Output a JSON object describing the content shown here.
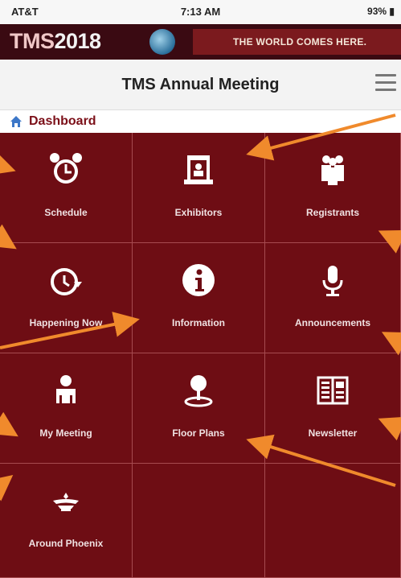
{
  "status": {
    "carrier": "AT&T",
    "time": "7:13 AM",
    "battery": "93%"
  },
  "banner": {
    "brand_prefix": "TMS",
    "brand_year": "2018",
    "tagline": "THE WORLD COMES HERE."
  },
  "header": {
    "title": "TMS Annual Meeting"
  },
  "breadcrumb": {
    "label": "Dashboard"
  },
  "tiles": [
    {
      "label": "Schedule",
      "icon": "alarm-clock-icon"
    },
    {
      "label": "Exhibitors",
      "icon": "exhibit-booth-icon"
    },
    {
      "label": "Registrants",
      "icon": "people-icon"
    },
    {
      "label": "Happening Now",
      "icon": "clock-arrow-icon"
    },
    {
      "label": "Information",
      "icon": "info-icon"
    },
    {
      "label": "Announcements",
      "icon": "microphone-icon"
    },
    {
      "label": "My Meeting",
      "icon": "person-icon"
    },
    {
      "label": "Floor Plans",
      "icon": "map-pin-icon"
    },
    {
      "label": "Newsletter",
      "icon": "newsletter-icon"
    },
    {
      "label": "Around Phoenix",
      "icon": "phoenix-icon"
    }
  ],
  "colors": {
    "tile_bg": "#6e0d14",
    "accent_arrow": "#f08a2c",
    "crumb_text": "#7b0f18"
  }
}
